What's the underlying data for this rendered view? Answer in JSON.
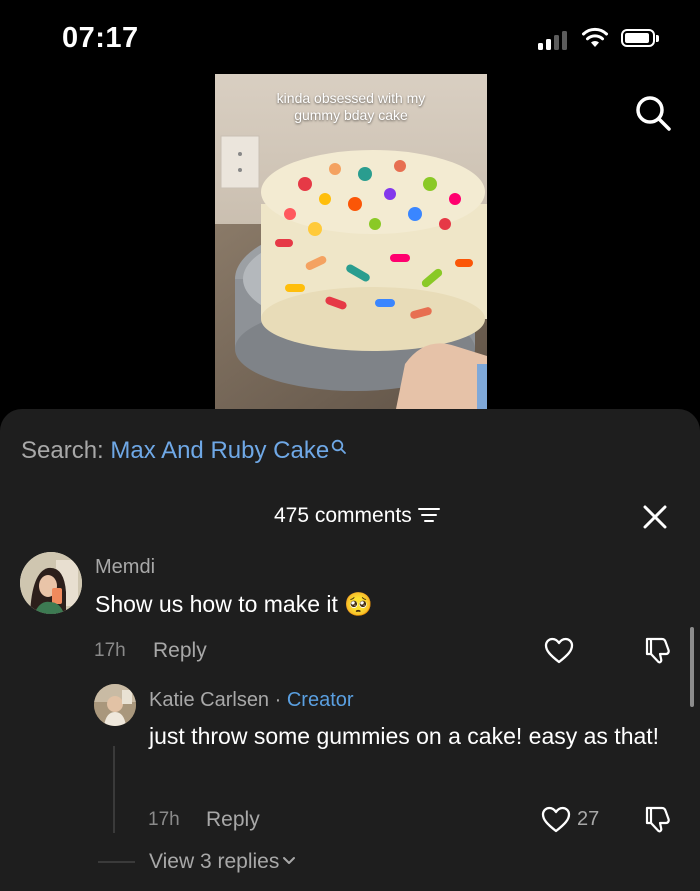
{
  "status_bar": {
    "time": "07:17"
  },
  "video": {
    "caption": "kinda obsessed with my\ngummy bday cake"
  },
  "search": {
    "label": "Search:",
    "query": "Max And Ruby Cake"
  },
  "comments_header": {
    "count_label": "475 comments"
  },
  "comments": [
    {
      "username": "Memdi",
      "text": "Show us how to make it",
      "emoji": "🥺",
      "time": "17h",
      "reply_label": "Reply"
    }
  ],
  "reply_comment": {
    "username": "Katie Carlsen",
    "separator": " · ",
    "badge": "Creator",
    "text": "just throw some gummies on a cake! easy as that!",
    "time": "17h",
    "reply_label": "Reply",
    "like_count": "27"
  },
  "view_replies_label": "View 3 replies",
  "colors": {
    "link_blue": "#6fa8e6",
    "creator_blue": "#5a9fe0",
    "sheet_bg": "#1e1e1e"
  }
}
